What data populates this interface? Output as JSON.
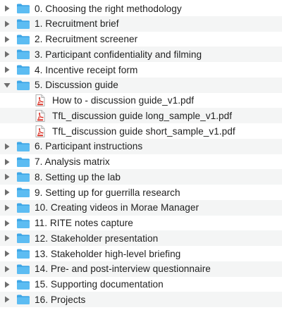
{
  "items": [
    {
      "label": "0. Choosing the right methodology",
      "type": "folder",
      "expanded": false
    },
    {
      "label": "1. Recruitment brief",
      "type": "folder",
      "expanded": false
    },
    {
      "label": "2. Recruitment screener",
      "type": "folder",
      "expanded": false
    },
    {
      "label": "3. Participant confidentiality and filming",
      "type": "folder",
      "expanded": false
    },
    {
      "label": "4. Incentive receipt form",
      "type": "folder",
      "expanded": false
    },
    {
      "label": "5. Discussion guide",
      "type": "folder",
      "expanded": true,
      "children": [
        {
          "label": "How to - discussion guide_v1.pdf",
          "type": "pdf"
        },
        {
          "label": "TfL_discussion guide long_sample_v1.pdf",
          "type": "pdf"
        },
        {
          "label": "TfL_discussion guide short_sample_v1.pdf",
          "type": "pdf"
        }
      ]
    },
    {
      "label": "6. Participant instructions",
      "type": "folder",
      "expanded": false
    },
    {
      "label": "7. Analysis matrix",
      "type": "folder",
      "expanded": false
    },
    {
      "label": "8. Setting up the lab",
      "type": "folder",
      "expanded": false
    },
    {
      "label": "9. Setting up for guerrilla research",
      "type": "folder",
      "expanded": false
    },
    {
      "label": "10. Creating videos in Morae Manager",
      "type": "folder",
      "expanded": false
    },
    {
      "label": "11. RITE notes capture",
      "type": "folder",
      "expanded": false
    },
    {
      "label": "12. Stakeholder presentation",
      "type": "folder",
      "expanded": false
    },
    {
      "label": "13. Stakeholder high-level briefing",
      "type": "folder",
      "expanded": false
    },
    {
      "label": "14. Pre- and post-interview questionnaire",
      "type": "folder",
      "expanded": false
    },
    {
      "label": "15. Supporting documentation",
      "type": "folder",
      "expanded": false
    },
    {
      "label": "16. Projects",
      "type": "folder",
      "expanded": false
    }
  ],
  "colors": {
    "folder_front": "#5cbcf2",
    "folder_back": "#3ea6e6",
    "row_alt": "#f4f5f5",
    "disclosure": "#6e6e6e",
    "pdf_red": "#d93025"
  },
  "icons": {
    "folder": "folder-icon",
    "pdf": "pdf-file-icon",
    "collapsed": "disclosure-right-icon",
    "expanded": "disclosure-down-icon"
  }
}
